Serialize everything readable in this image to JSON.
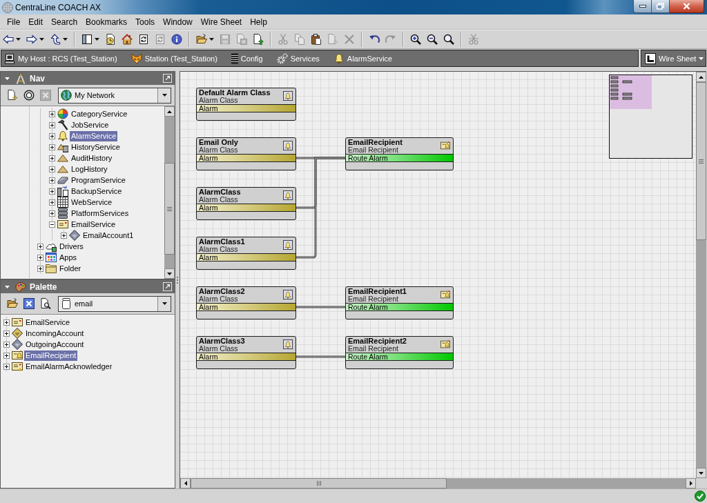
{
  "window": {
    "title": "CentraLine COACH AX"
  },
  "menu": [
    "File",
    "Edit",
    "Search",
    "Bookmarks",
    "Tools",
    "Window",
    "Wire Sheet",
    "Help"
  ],
  "toolbar": [
    [
      {
        "kind": "back",
        "dropdown": true,
        "disabled": false
      },
      {
        "kind": "forward",
        "dropdown": true,
        "disabled": false
      },
      {
        "kind": "up",
        "dropdown": true,
        "disabled": false
      }
    ],
    [
      {
        "kind": "sidebar",
        "dropdown": true,
        "disabled": false
      },
      {
        "kind": "recent",
        "dropdown": false,
        "disabled": false
      },
      {
        "kind": "home",
        "dropdown": false,
        "disabled": false
      },
      {
        "kind": "refresh",
        "dropdown": false,
        "disabled": false
      },
      {
        "kind": "refresh",
        "dropdown": false,
        "disabled": true
      },
      {
        "kind": "info",
        "dropdown": false,
        "disabled": false
      }
    ],
    [
      {
        "kind": "open",
        "dropdown": true,
        "disabled": false
      },
      {
        "kind": "save",
        "dropdown": false,
        "disabled": true
      },
      {
        "kind": "saveall",
        "dropdown": false,
        "disabled": true
      },
      {
        "kind": "new",
        "dropdown": false,
        "disabled": false
      }
    ],
    [
      {
        "kind": "cut",
        "dropdown": false,
        "disabled": true
      },
      {
        "kind": "copy",
        "dropdown": false,
        "disabled": true
      },
      {
        "kind": "paste",
        "dropdown": false,
        "disabled": false
      },
      {
        "kind": "pastespecial",
        "dropdown": false,
        "disabled": true
      },
      {
        "kind": "delete",
        "dropdown": false,
        "disabled": true
      }
    ],
    [
      {
        "kind": "undo",
        "dropdown": false,
        "disabled": false
      },
      {
        "kind": "redo",
        "dropdown": false,
        "disabled": true
      }
    ],
    [
      {
        "kind": "zoomin",
        "dropdown": false,
        "disabled": false
      },
      {
        "kind": "zoomout",
        "dropdown": false,
        "disabled": false
      },
      {
        "kind": "zoomfit",
        "dropdown": false,
        "disabled": false
      }
    ],
    [
      {
        "kind": "scissors",
        "dropdown": false,
        "disabled": true
      }
    ]
  ],
  "path_bar": {
    "items": [
      {
        "kind": "host",
        "label": "My Host : RCS (Test_Station)"
      },
      {
        "kind": "station",
        "label": "Station (Test_Station)"
      },
      {
        "kind": "config",
        "label": "Config"
      },
      {
        "kind": "services",
        "label": "Services"
      },
      {
        "kind": "alarm",
        "label": "AlarmService"
      }
    ],
    "view": "Wire Sheet"
  },
  "nav": {
    "title": "Nav",
    "tools": [
      {
        "kind": "newdoc",
        "disabled": false
      },
      {
        "kind": "target",
        "disabled": false
      },
      {
        "kind": "close",
        "disabled": true
      }
    ],
    "network": "My Network",
    "tree": [
      {
        "children": [
          {
            "kind": "category",
            "label": "CategoryService",
            "expanded": false,
            "selected": false
          },
          {
            "kind": "job",
            "label": "JobService",
            "expanded": false,
            "selected": false
          },
          {
            "kind": "alarm",
            "label": "AlarmService",
            "expanded": false,
            "selected": true
          },
          {
            "kind": "history",
            "label": "HistoryService",
            "expanded": false,
            "selected": false
          },
          {
            "kind": "historylog",
            "label": "AuditHistory",
            "expanded": false,
            "selected": false
          },
          {
            "kind": "historylog",
            "label": "LogHistory",
            "expanded": false,
            "selected": false
          },
          {
            "kind": "program",
            "label": "ProgramService",
            "expanded": false,
            "selected": false
          },
          {
            "kind": "backup",
            "label": "BackupService",
            "expanded": false,
            "selected": false
          },
          {
            "kind": "web",
            "label": "WebService",
            "expanded": false,
            "selected": false
          },
          {
            "kind": "platform",
            "label": "PlatformServices",
            "expanded": false,
            "selected": false
          },
          {
            "kind": "email",
            "label": "EmailService",
            "expanded": true,
            "selected": false,
            "children": [
              {
                "kind": "account",
                "label": "EmailAccount1",
                "expanded": false,
                "selected": false
              }
            ]
          }
        ]
      },
      {
        "kind": "drivers",
        "label": "Drivers",
        "expanded": false,
        "selected": false
      },
      {
        "kind": "apps",
        "label": "Apps",
        "expanded": false,
        "selected": false
      },
      {
        "kind": "folder",
        "label": "Folder",
        "expanded": false,
        "selected": false
      }
    ]
  },
  "palette": {
    "title": "Palette",
    "tools": [
      {
        "kind": "open",
        "disabled": false
      },
      {
        "kind": "close",
        "disabled": false
      },
      {
        "kind": "find",
        "disabled": false
      }
    ],
    "module": "email",
    "items": [
      {
        "kind": "email",
        "label": "EmailService",
        "expanded": false,
        "selected": false
      },
      {
        "kind": "incoming",
        "label": "IncomingAccount",
        "expanded": false,
        "selected": false
      },
      {
        "kind": "account",
        "label": "OutgoingAccount",
        "expanded": false,
        "selected": false
      },
      {
        "kind": "recipient",
        "label": "EmailRecipient",
        "expanded": false,
        "selected": true
      },
      {
        "kind": "acknowledger",
        "label": "EmailAlarmAcknowledger",
        "expanded": false,
        "selected": false
      }
    ]
  },
  "wire_sheet": {
    "groups": [
      {
        "sources": [
          {
            "name": "Default Alarm Class",
            "type": "Alarm Class",
            "slot": "Alarm"
          }
        ]
      },
      {
        "sources": [
          {
            "name": "Email Only",
            "type": "Alarm Class",
            "slot": "Alarm"
          },
          {
            "name": "AlarmClass",
            "type": "Alarm Class",
            "slot": "Alarm"
          },
          {
            "name": "AlarmClass1",
            "type": "Alarm Class",
            "slot": "Alarm"
          }
        ],
        "target": {
          "name": "EmailRecipient",
          "type": "Email Recipient",
          "slot": "Route Alarm"
        }
      },
      {
        "sources": [
          {
            "name": "AlarmClass2",
            "type": "Alarm Class",
            "slot": "Alarm"
          }
        ],
        "target": {
          "name": "EmailRecipient1",
          "type": "Email Recipient",
          "slot": "Route Alarm"
        }
      },
      {
        "sources": [
          {
            "name": "AlarmClass3",
            "type": "Alarm Class",
            "slot": "Alarm"
          }
        ],
        "target": {
          "name": "EmailRecipient2",
          "type": "Email Recipient",
          "slot": "Route Alarm"
        }
      }
    ]
  }
}
